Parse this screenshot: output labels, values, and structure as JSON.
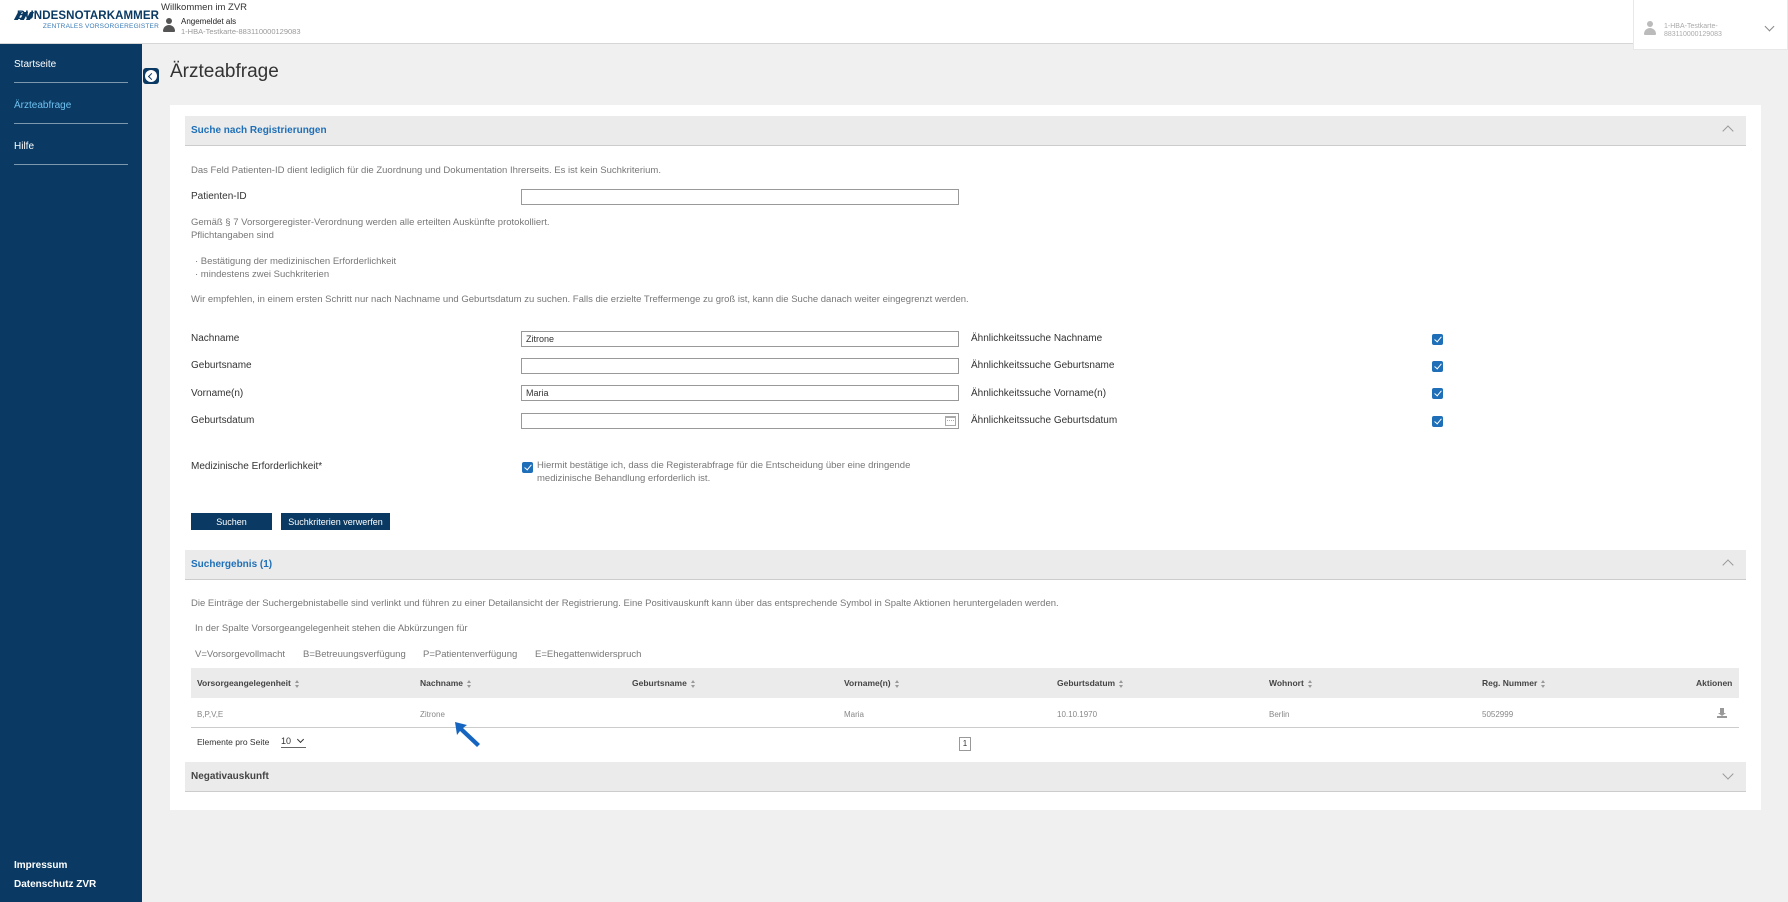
{
  "header": {
    "logo_main": "BUNDESNOTARKAMMER",
    "logo_sub": "ZENTRALES VORSORGEREGISTER",
    "welcome": "Willkommen im ZVR",
    "logged_label": "Angemeldet als",
    "logged_id": "1-HBA-Testkarte-883110000129083",
    "user_menu_text": "1-HBA-Testkarte-883110000129083"
  },
  "sidebar": {
    "items": [
      {
        "label": "Startseite"
      },
      {
        "label": "Ärzteabfrage"
      },
      {
        "label": "Hilfe"
      }
    ],
    "footer": [
      {
        "label": "Impressum"
      },
      {
        "label": "Datenschutz ZVR"
      }
    ]
  },
  "page": {
    "title": "Ärzteabfrage"
  },
  "search": {
    "section_title": "Suche nach Registrierungen",
    "intro": "Das Feld Patienten-ID dient lediglich für die Zuordnung und Dokumentation Ihrerseits. Es ist kein Suchkriterium.",
    "patient_id_label": "Patienten-ID",
    "patient_id_value": "",
    "protocol_note": "Gemäß § 7 Vorsorgeregister-Verordnung werden alle erteilten Auskünfte protokolliert.",
    "mandatory_intro": "Pflichtangaben sind",
    "mandatory_1": "· Bestätigung der medizinischen Erforderlichkeit",
    "mandatory_2": "· mindestens zwei Suchkriterien",
    "recommendation": "Wir empfehlen, in einem ersten Schritt nur nach Nachname und Geburtsdatum zu suchen. Falls die erzielte Treffermenge zu groß ist, kann die Suche danach weiter eingegrenzt werden.",
    "fields": [
      {
        "label": "Nachname",
        "value": "Zitrone",
        "similar_label": "Ähnlichkeitssuche Nachname",
        "similar_checked": true
      },
      {
        "label": "Geburtsname",
        "value": "",
        "similar_label": "Ähnlichkeitssuche Geburtsname",
        "similar_checked": true
      },
      {
        "label": "Vorname(n)",
        "value": "Maria",
        "similar_label": "Ähnlichkeitssuche Vorname(n)",
        "similar_checked": true
      },
      {
        "label": "Geburtsdatum",
        "value": "",
        "similar_label": "Ähnlichkeitssuche Geburtsdatum",
        "similar_checked": true
      }
    ],
    "medical_label": "Medizinische Erforderlichkeit*",
    "medical_checked": true,
    "medical_text_1": "Hiermit bestätige ich, dass die Registerabfrage für die Entscheidung über eine dringende",
    "medical_text_2": "medizinische Behandlung erforderlich ist.",
    "search_button": "Suchen",
    "reset_button": "Suchkriterien verwerfen"
  },
  "results": {
    "section_title": "Suchergebnis (1)",
    "info": "Die Einträge der Suchergebnistabelle sind verlinkt und führen zu einer Detailansicht der Registrierung. Eine Positivauskunft kann über das entsprechende Symbol in Spalte Aktionen heruntergeladen werden.",
    "abbrev_intro": "In der Spalte Vorsorgeangelegenheit stehen die Abkürzungen für",
    "abbrevs": [
      "V=Vorsorgevollmacht",
      "B=Betreuungsverfügung",
      "P=Patientenverfügung",
      "E=Ehegattenwiderspruch"
    ],
    "columns": [
      "Vorsorgeangelegenheit",
      "Nachname",
      "Geburtsname",
      "Vorname(n)",
      "Geburtsdatum",
      "Wohnort",
      "Reg. Nummer",
      "Aktionen"
    ],
    "rows": [
      [
        "B,P,V,E",
        "Zitrone",
        "",
        "Maria",
        "10.10.1970",
        "Berlin",
        "5052999"
      ]
    ],
    "per_page_label": "Elemente pro Seite",
    "per_page_value": "10",
    "current_page": "1"
  },
  "negative": {
    "section_title": "Negativauskunft"
  },
  "colors": {
    "navy": "#0a3a63",
    "link_blue": "#1e6fb8",
    "active_nav": "#6ec0f0",
    "pointer_blue": "#1565c0"
  }
}
